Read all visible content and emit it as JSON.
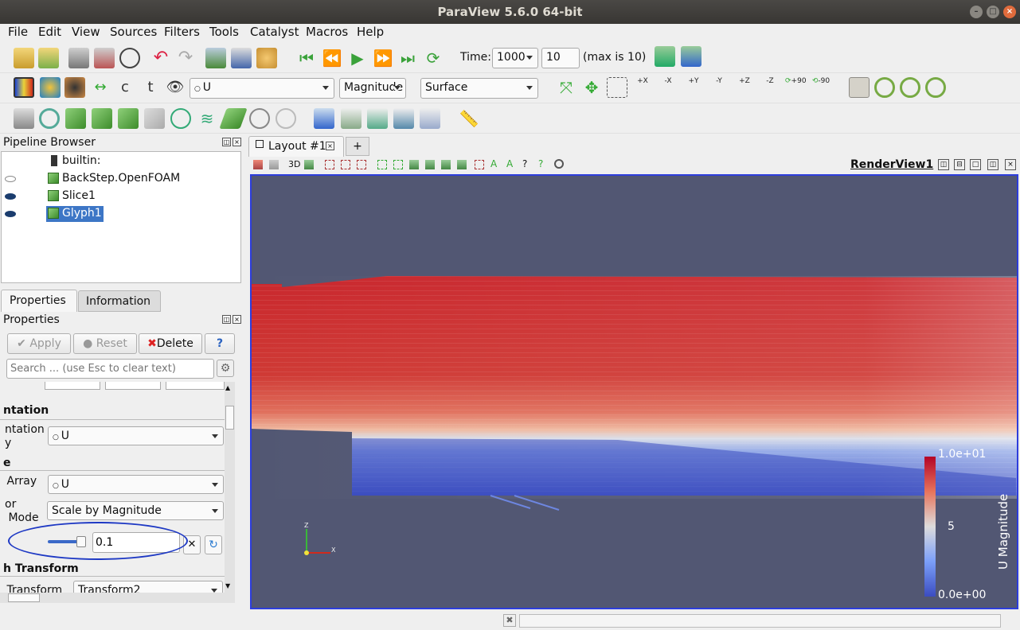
{
  "window": {
    "title": "ParaView 5.6.0 64-bit"
  },
  "menu": {
    "items": [
      "File",
      "Edit",
      "View",
      "Sources",
      "Filters",
      "Tools",
      "Catalyst",
      "Macros",
      "Help"
    ]
  },
  "toolbar1": {
    "time_label": "Time:",
    "time_value": "1000",
    "step_value": "10",
    "max_label": "(max is 10)"
  },
  "toolbar2": {
    "array_select": "U",
    "component_select": "Magnitude",
    "representation_select": "Surface",
    "camera_labels": [
      "+X",
      "-X",
      "+Y",
      "-Y",
      "+Z",
      "-Z",
      "+90",
      "-90"
    ]
  },
  "pipeline": {
    "title": "Pipeline Browser",
    "items": [
      "builtin:",
      "BackStep.OpenFOAM",
      "Slice1",
      "Glyph1"
    ],
    "selected": "Glyph1"
  },
  "tabs": {
    "properties": "Properties",
    "information": "Information"
  },
  "properties": {
    "section_title": "Properties",
    "apply_label": "Apply",
    "reset_label": "Reset",
    "delete_label": "Delete",
    "help_label": "?",
    "search_placeholder": "Search ... (use Esc to clear text)",
    "rows": {
      "orientation_header": "ntation",
      "orientation_label": "ntation\ny",
      "orientation_value": "U",
      "scale_header": "e",
      "scale_array_label": " Array",
      "scale_array_value": "U",
      "vector_label": "or\n Mode",
      "vector_mode_value": "Scale by Magnitude",
      "scale_factor_value": "0.1",
      "transform_header": "h Transform",
      "transform_label": " Transform",
      "transform_value": "Transform2"
    }
  },
  "layout": {
    "tab_label": "Layout #1",
    "add_tab": "+",
    "view_name": "RenderView1",
    "mode_3d": "3D"
  },
  "colorbar": {
    "title": "U Magnitude",
    "max_label": "1.0e+01",
    "mid_label": "5",
    "min_label": "0.0e+00"
  },
  "axes": {
    "z": "Z",
    "x": "X"
  },
  "colors": {
    "accent": "#2d3ddc",
    "selected": "#3d76c6",
    "annotation": "#e0161d",
    "background": "#525773"
  }
}
